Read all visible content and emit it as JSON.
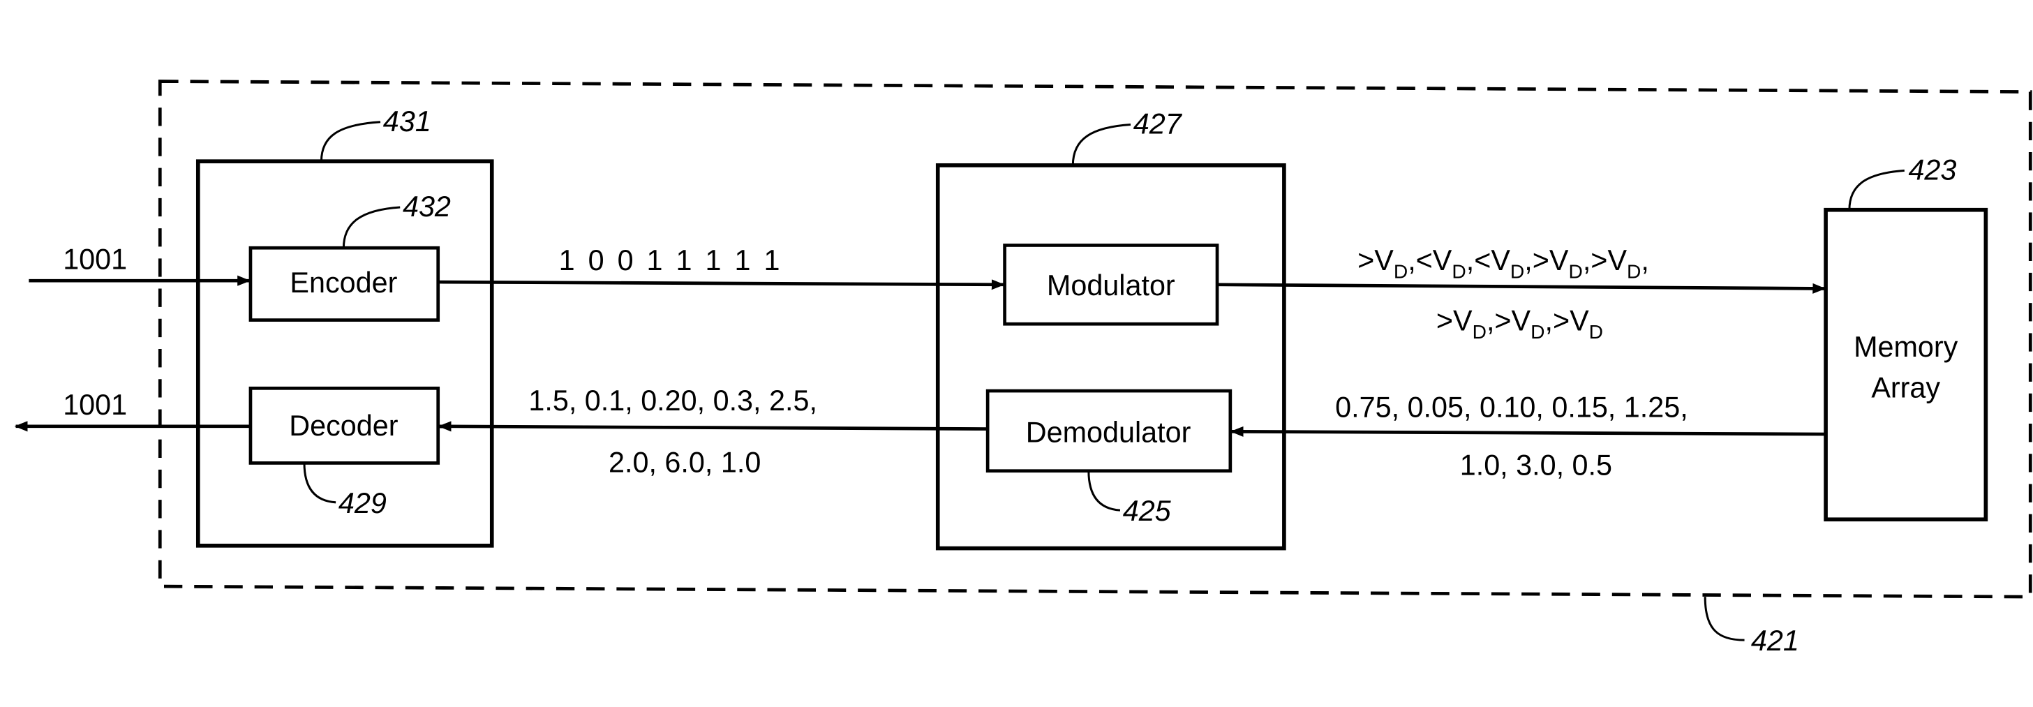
{
  "figure": {
    "container_ref": "421",
    "blocks": {
      "codec": {
        "ref": "431"
      },
      "encoder": {
        "label": "Encoder",
        "ref": "432"
      },
      "decoder": {
        "label": "Decoder",
        "ref": "429"
      },
      "modem": {
        "ref": "427"
      },
      "modulator": {
        "label": "Modulator"
      },
      "demodulator": {
        "label": "Demodulator",
        "ref": "425"
      },
      "memory_array": {
        "label_line1": "Memory",
        "label_line2": "Array",
        "ref": "423"
      }
    },
    "signals": {
      "input_data": "1001",
      "output_data": "1001",
      "encoded_bits": "1 0 0 1 1 1 1 1",
      "modulated": {
        "line1": [
          ">V",
          "D",
          ",<V",
          "D",
          ",<V",
          "D",
          ",>V",
          "D",
          ",>V",
          "D",
          ","
        ],
        "line2": [
          ">V",
          "D",
          ",>V",
          "D",
          ",>V",
          "D"
        ]
      },
      "read_values_line1": "0.75, 0.05, 0.10, 0.15, 1.25,",
      "read_values_line2": "1.0, 3.0, 0.5",
      "demod_values_line1": "1.5, 0.1, 0.20, 0.3, 2.5,",
      "demod_values_line2": "2.0, 6.0, 1.0"
    }
  }
}
